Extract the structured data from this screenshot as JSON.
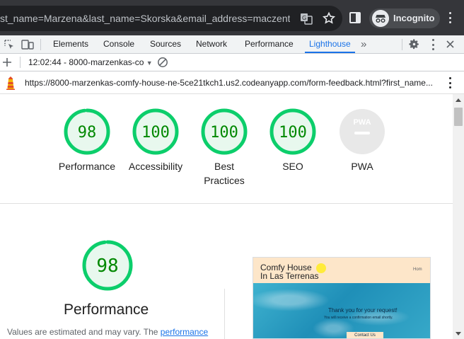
{
  "browser": {
    "omnibox_text": "st_name=Marzena&last_name=Skorska&email_address=maczent...",
    "incognito_label": "Incognito"
  },
  "devtools": {
    "tabs": [
      {
        "label": "Elements"
      },
      {
        "label": "Console"
      },
      {
        "label": "Sources"
      },
      {
        "label": "Network"
      },
      {
        "label": "Performance"
      },
      {
        "label": "Lighthouse",
        "active": true
      }
    ],
    "more_tabs": "»"
  },
  "lighthouse": {
    "report_select": "12:02:44 - 8000-marzenkas-co",
    "url": "https://8000-marzenkas-comfy-house-ne-5ce21tkch1.us2.codeanyapp.com/form-feedback.html?first_name...",
    "gauges": [
      {
        "score": "98",
        "label": "Performance"
      },
      {
        "score": "100",
        "label": "Accessibility"
      },
      {
        "score": "100",
        "label": "Best Practices"
      },
      {
        "score": "100",
        "label": "SEO"
      },
      {
        "score": "PWA",
        "label": "PWA"
      }
    ],
    "performance": {
      "score": "98",
      "title": "Performance",
      "description": "Values are estimated and may vary. The ",
      "link_text": "performance"
    },
    "colors": {
      "pass": "#0cce6b",
      "pass_text": "#008800",
      "pass_bg": "#e8f8ee",
      "pwa_bg": "#e8e8e8"
    }
  },
  "thumbnail": {
    "title_line1": "Comfy House",
    "title_line2": "In Las Terrenas",
    "nav": "Hom",
    "thanks": "Thank you for your request!",
    "sub": "You will receive a confirmation email shortly.",
    "button": "Contact Us"
  }
}
